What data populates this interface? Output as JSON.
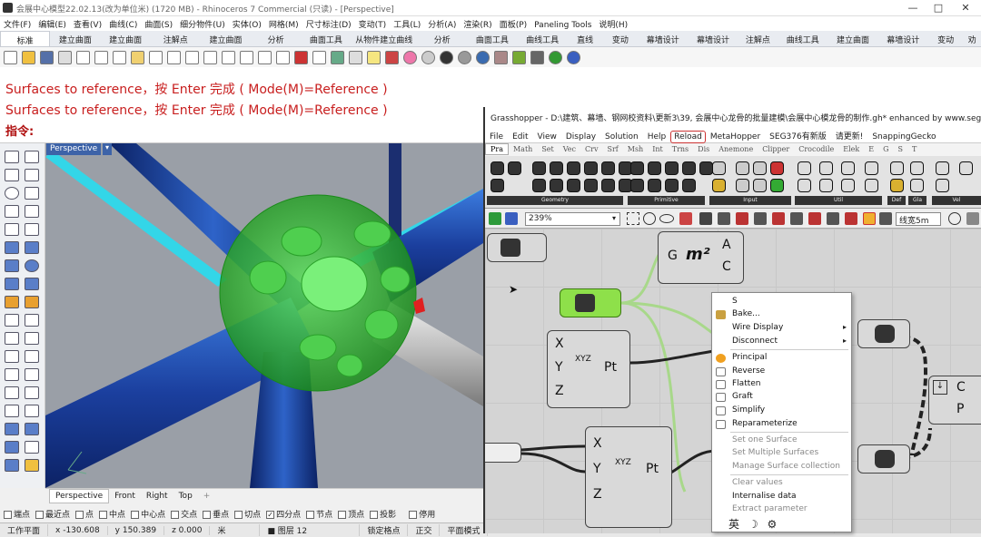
{
  "rhino": {
    "title": "会展中心模型22.02.13(改为单位米) (1720 MB) - Rhinoceros 7 Commercial (只读) - [Perspective]",
    "window_buttons": [
      "—",
      "□",
      "✕"
    ],
    "menu": [
      "文件(F)",
      "编辑(E)",
      "查看(V)",
      "曲线(C)",
      "曲面(S)",
      "细分物件(U)",
      "实体(O)",
      "网格(M)",
      "尺寸标注(D)",
      "变动(T)",
      "工具(L)",
      "分析(A)",
      "渲染(R)",
      "面板(P)",
      "Paneling Tools",
      "说明(H)"
    ],
    "tabs": [
      "标准",
      "建立曲面",
      "建立曲面",
      "注解点",
      "建立曲面",
      "分析",
      "曲面工具",
      "从物件建立曲线",
      "分析",
      "曲面工具",
      "曲线工具",
      "直线",
      "变动",
      "幕墙设计",
      "幕墙设计",
      "注解点",
      "曲线工具",
      "建立曲面",
      "幕墙设计",
      "变动",
      "劝"
    ],
    "active_tab_index": 0,
    "command_history": [
      "Surfaces to reference，按 Enter 完成 ( Mode(M)=Reference )",
      "Surfaces to reference，按 Enter 完成 ( Mode(M)=Reference )"
    ],
    "command_prompt": "指令:",
    "viewport_label": "Perspective",
    "viewport_tabs": [
      "Perspective",
      "Front",
      "Right",
      "Top",
      "+"
    ],
    "osnaps": [
      {
        "label": "端点",
        "checked": false
      },
      {
        "label": "最近点",
        "checked": false
      },
      {
        "label": "点",
        "checked": false
      },
      {
        "label": "中点",
        "checked": false
      },
      {
        "label": "中心点",
        "checked": false
      },
      {
        "label": "交点",
        "checked": false
      },
      {
        "label": "垂点",
        "checked": false
      },
      {
        "label": "切点",
        "checked": false
      },
      {
        "label": "四分点",
        "checked": true
      },
      {
        "label": "节点",
        "checked": false
      },
      {
        "label": "顶点",
        "checked": false
      },
      {
        "label": "投影",
        "checked": false
      },
      {
        "label": "停用",
        "checked": false
      }
    ],
    "status": {
      "cplane": "工作平面",
      "x": "x -130.608",
      "y": "y 150.389",
      "z": "z 0.000",
      "unit": "米",
      "layer": "■ 图层 12",
      "lock": "锁定格点",
      "ortho": "正交",
      "planar": "平面模式"
    }
  },
  "grasshopper": {
    "title": "Grasshopper - D:\\建筑、幕墙、钢网校资料\\更新3\\39, 会展中心龙骨的批量建模\\会展中心模龙骨的制作.gh*  enhanced by www.seggh.com",
    "menu": [
      "File",
      "Edit",
      "View",
      "Display",
      "Solution",
      "Help",
      "Reload",
      "MetaHopper",
      "SEG376有新版",
      "请更新!",
      "SnappingGecko"
    ],
    "tabs": [
      "Pra",
      "Math",
      "Set",
      "Vec",
      "Crv",
      "Srf",
      "Msh",
      "Int",
      "Trns",
      "Dis",
      "Anemone",
      "Clipper",
      "Crocodile",
      "Elek",
      "E",
      "G",
      "S",
      "T"
    ],
    "ribbon_groups": [
      "Geometry",
      "Primitive",
      "Input",
      "Util",
      "Def",
      "Gla",
      "Vel"
    ],
    "zoom": "239%",
    "line_style": "线宽5m",
    "components": {
      "area_outputs": [
        "A",
        "C"
      ],
      "area_labels": [
        "G",
        "m²"
      ],
      "pt1_inputs": [
        "X",
        "Y",
        "Z"
      ],
      "pt1_label": "Pt",
      "pt2_inputs": [
        "X",
        "Y",
        "Z"
      ],
      "pt2_label": "Pt",
      "xyz_glyph": "XYZ",
      "right_outputs": [
        "C",
        "P"
      ]
    },
    "context_menu": {
      "name_field": "S",
      "items": [
        {
          "label": "Bake...",
          "enabled": true,
          "submenu": false
        },
        {
          "label": "Wire Display",
          "enabled": true,
          "submenu": true
        },
        {
          "label": "Disconnect",
          "enabled": true,
          "submenu": true
        },
        {
          "label": "Principal",
          "enabled": true,
          "submenu": false
        },
        {
          "label": "Reverse",
          "enabled": true,
          "submenu": false
        },
        {
          "label": "Flatten",
          "enabled": true,
          "submenu": false
        },
        {
          "label": "Graft",
          "enabled": true,
          "submenu": false
        },
        {
          "label": "Simplify",
          "enabled": true,
          "submenu": false
        },
        {
          "label": "Reparameterize",
          "enabled": true,
          "submenu": false
        },
        {
          "label": "Set one Surface",
          "enabled": false,
          "submenu": false
        },
        {
          "label": "Set Multiple Surfaces",
          "enabled": false,
          "submenu": false
        },
        {
          "label": "Manage Surface collection",
          "enabled": false,
          "submenu": false
        },
        {
          "label": "Clear values",
          "enabled": false,
          "submenu": false
        },
        {
          "label": "Internalise data",
          "enabled": true,
          "submenu": false
        },
        {
          "label": "Extract parameter",
          "enabled": false,
          "submenu": false
        }
      ],
      "ime_bar": [
        "英",
        "☽",
        "⚙"
      ]
    }
  }
}
